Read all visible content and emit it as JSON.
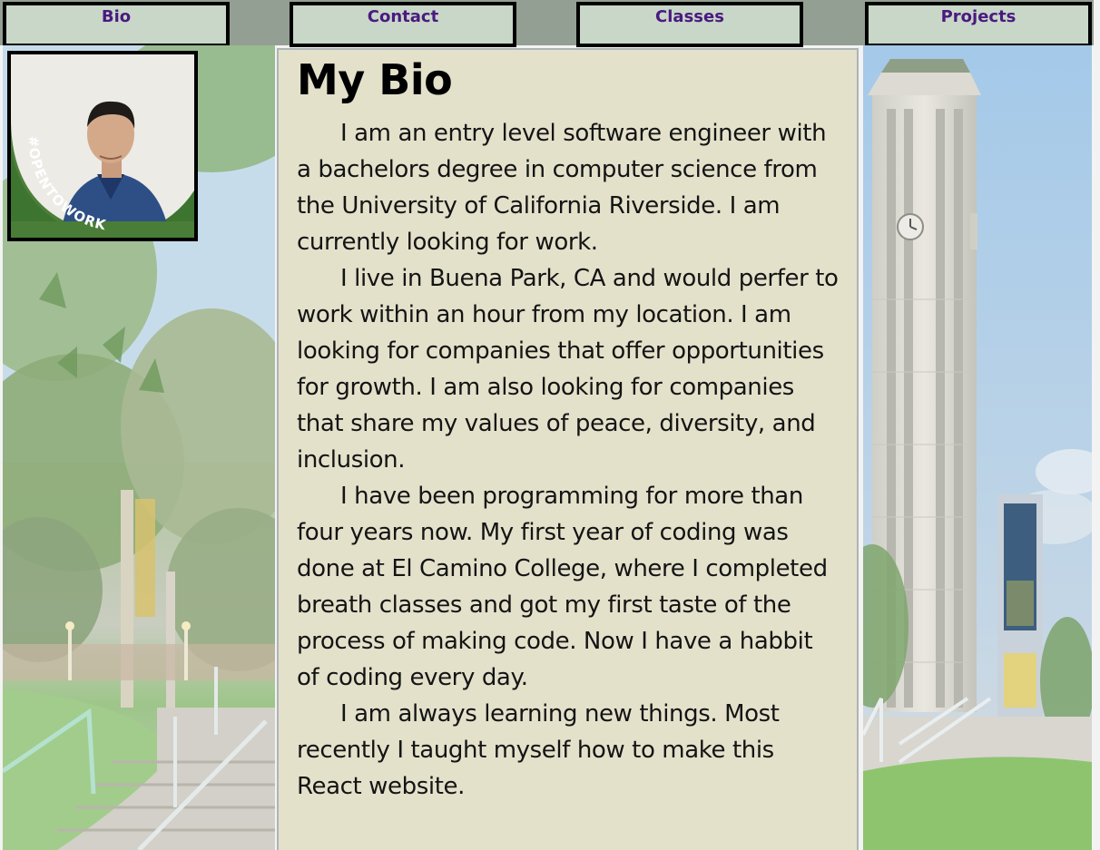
{
  "nav": {
    "bio": "Bio",
    "contact": "Contact",
    "classes": "Classes",
    "projects": "Projects"
  },
  "profile": {
    "badge_text": "#OPENTOWORK"
  },
  "bio": {
    "title": "My Bio",
    "paragraphs": [
      "I am an entry level software engineer with a bachelors degree in computer science from the University of California Riverside. I am currently looking for work.",
      "I live in Buena Park, CA and would perfer to work within an hour from my location. I am looking for companies that offer opportunities for growth. I am also looking for companies that share my values of peace, diversity, and inclusion.",
      "I have been programming for more than four years now. My first year of coding was done at El Camino College, where I completed breath classes and got my first taste of the process of making code. Now I have a habbit of coding every day.",
      "I am always learning new things. Most recently I taught myself how to make this React website."
    ]
  },
  "colors": {
    "nav_bg": "#939f92",
    "nav_button_bg": "#c8d7c8",
    "nav_text": "#4a1a80",
    "bio_bg": "#e4e1cb"
  }
}
